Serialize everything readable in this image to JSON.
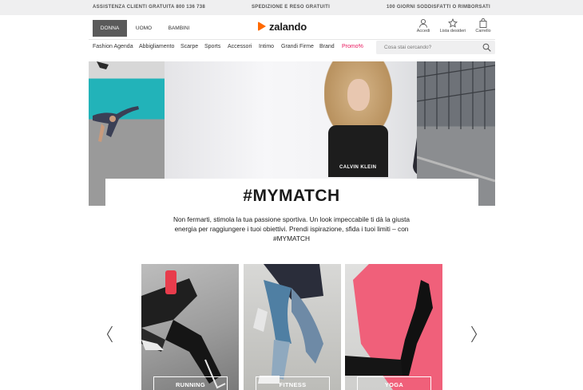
{
  "topbar": {
    "left": "ASSISTENZA CLIENTI GRATUITA 800 136 738",
    "center": "SPEDIZIONE E RESO GRATUITI",
    "right": "100 GIORNI SODDISFATTI O RIMBORSATI"
  },
  "header": {
    "genders": [
      "DONNA",
      "UOMO",
      "BAMBINI"
    ],
    "active_gender": "DONNA",
    "logo": "zalando",
    "actions": [
      {
        "label": "Accedi",
        "icon": "user-icon"
      },
      {
        "label": "Lista desideri",
        "icon": "star-icon"
      },
      {
        "label": "Carrello",
        "icon": "bag-icon"
      }
    ]
  },
  "nav": {
    "items": [
      "Fashion Agenda",
      "Abbigliamento",
      "Scarpe",
      "Sports",
      "Accessori",
      "Intimo",
      "Grandi Firme",
      "Brand",
      "Promo%"
    ],
    "promo_color": "#e8165c"
  },
  "search": {
    "placeholder": "Cosa stai cercando?"
  },
  "hero": {
    "title": "#MYMATCH",
    "text": "Non fermarti, stimola la tua passione sportiva. Un look impeccabile ti dà la giusta energia per raggiungere i tuoi obiettivi. Prendi ispirazione, sfida i tuoi limiti – con #MYMATCH",
    "shirt_print": "CALVIN KLEIN"
  },
  "carousel": {
    "cards": [
      {
        "label": "RUNNING"
      },
      {
        "label": "FITNESS"
      },
      {
        "label": "YOGA"
      }
    ]
  },
  "colors": {
    "brand": "#ff6900",
    "topbar_bg": "#efeff0",
    "active_gender_bg": "#5a5a5a"
  }
}
